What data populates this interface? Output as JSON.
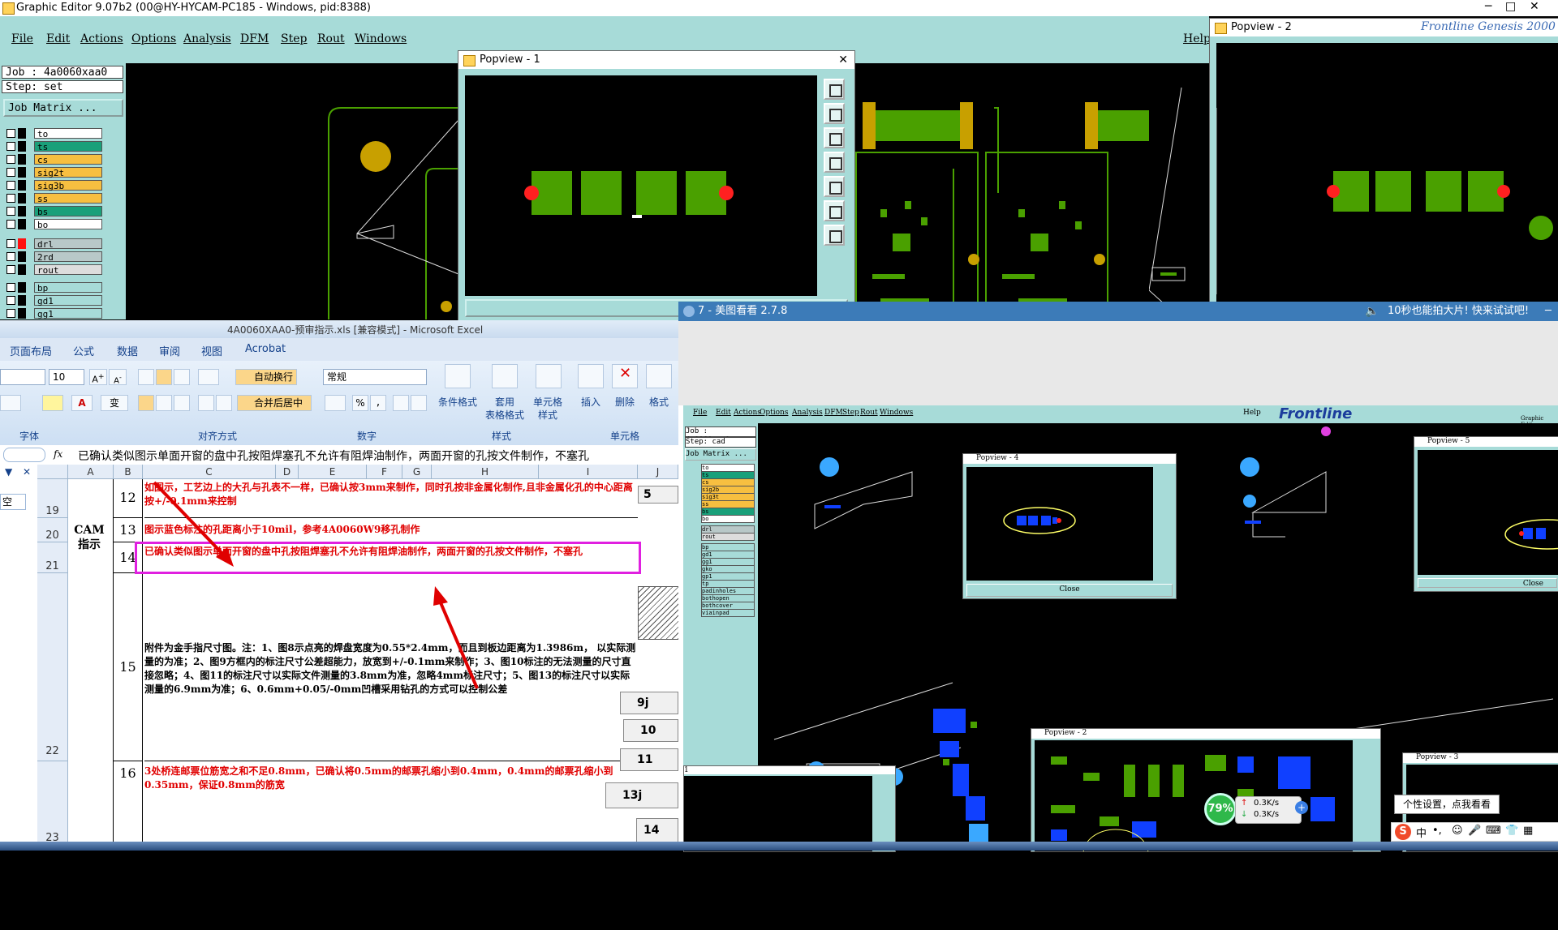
{
  "graphic_editor": {
    "title": "Graphic Editor 9.07b2 (00@HY-HYCAM-PC185 - Windows, pid:8388)",
    "menu": [
      "File",
      "Edit",
      "Actions",
      "Options",
      "Analysis",
      "DFM",
      "Step",
      "Rout",
      "Windows"
    ],
    "help": "Help",
    "job": "Job : 4a0060xaa0",
    "step": "Step: set",
    "job_matrix": "Job Matrix ...",
    "layers": [
      {
        "name": "to",
        "color": "#ffffff"
      },
      {
        "name": "ts",
        "color": "#1aa07a"
      },
      {
        "name": "cs",
        "color": "#f7bf40"
      },
      {
        "name": "sig2t",
        "color": "#f7bf40"
      },
      {
        "name": "sig3b",
        "color": "#f7bf40"
      },
      {
        "name": "ss",
        "color": "#f7bf40"
      },
      {
        "name": "bs",
        "color": "#1aa07a"
      },
      {
        "name": "bo",
        "color": "#ffffff"
      },
      {
        "name": "drl",
        "color": "#b8c8c8"
      },
      {
        "name": "2rd",
        "color": "#b8c8c8"
      },
      {
        "name": "rout",
        "color": "#dddddd"
      },
      {
        "name": "bp",
        "color": "#a7dbd8"
      },
      {
        "name": "gd1",
        "color": "#a7dbd8"
      },
      {
        "name": "gg1",
        "color": "#a7dbd8"
      }
    ],
    "popview1_title": "Popview - 1",
    "popview1_close": "Close",
    "popview2_title": "Popview - 2",
    "bg_logo": "Frontline  Genesis 2000"
  },
  "excel": {
    "title": "4A0060XAA0-预审指示.xls [兼容模式] - Microsoft Excel",
    "tabs": [
      "页面布局",
      "公式",
      "数据",
      "审阅",
      "视图",
      "Acrobat"
    ],
    "font_size": "10",
    "wrap_text": "自动换行",
    "merge_center": "合并后居中",
    "number_format": "常规",
    "groups": [
      "字体",
      "对齐方式",
      "数字",
      "样式",
      "单元格"
    ],
    "buttons": {
      "cond_format": "条件格式",
      "table_format_1": "套用",
      "table_format_2": "表格格式",
      "cell_style_1": "单元格",
      "cell_style_2": "样式",
      "insert": "插入",
      "delete": "删除",
      "format": "格式"
    },
    "formula_text": "已确认类似图示单面开窗的盘中孔按阻焊塞孔不允许有阻焊油制作，两面开窗的孔按文件制作，不塞孔",
    "columns": [
      "A",
      "B",
      "C",
      "D",
      "E",
      "F",
      "G",
      "H",
      "I",
      "J"
    ],
    "rows": [
      "19",
      "20",
      "21",
      "22",
      "23"
    ],
    "cam_label": "CAM指示",
    "left_pane_cell": "空",
    "items": [
      {
        "num": "12",
        "text": "如图示，工艺边上的大孔与孔表不一样，已确认按3mm来制作，同时孔按非金属化制作,且非金属化孔的中心距离按+/-0.1mm来控制"
      },
      {
        "num": "13",
        "text": "图示蓝色标注的孔距离小于10mil，参考4A0060W9移孔制作"
      },
      {
        "num": "14",
        "text": "已确认类似图示单面开窗的盘中孔按阻焊塞孔不允许有阻焊油制作，两面开窗的孔按文件制作，不塞孔"
      },
      {
        "num": "15",
        "text": "附件为金手指尺寸图。注：1、图8示点亮的焊盘宽度为0.55*2.4mm，而且到板边距离为1.3986m， 以实际测量的为准；2、图9方框内的标注尺寸公差超能力，放宽到+/-0.1mm来制作；3、图10标注的无法测量的尺寸直接忽略；4、图11的标注尺寸以实际文件测量的3.8mm为准，忽略4mm标注尺寸；5、图13的标注尺寸以实际测量的6.9mm为准；6、0.6mm+0.05/-0mm凹槽采用钻孔的方式可以控制公差"
      },
      {
        "num": "16",
        "text": "3处桥连邮票位筋宽之和不足0.8mm，已确认将0.5mm的邮票孔缩小到0.4mm，0.4mm的邮票孔缩小到0.35mm，保证0.8mm的筋宽"
      }
    ],
    "side_labels": [
      "5",
      "9j",
      "10",
      "11",
      "13j",
      "14"
    ]
  },
  "meitu": {
    "title": "7 - 美图看看 2.7.8",
    "ad": "10秒也能拍大片! 快来试试吧!",
    "inner": {
      "menu": [
        "File",
        "Edit",
        "Actions",
        "Options",
        "Analysis",
        "DFM",
        "Step",
        "Rout",
        "Windows"
      ],
      "help": "Help",
      "logo": "Frontline",
      "logo_sub": "Graphic Editor",
      "job": "Job : 4a0060xaa0",
      "step": "Step: cad",
      "job_matrix": "Job Matrix ...",
      "layers": [
        "to",
        "ts",
        "cs",
        "sig2b",
        "sig3t",
        "ss",
        "bs",
        "bo",
        "drl",
        "rout",
        "bp",
        "gd1",
        "gg1",
        "gko",
        "gp1",
        "tp",
        "padinholes",
        "bothopen",
        "bothcover",
        "viainpad"
      ],
      "pop4_title": "Popview - 4",
      "pop4_close": "Close",
      "pop5_title": "Popview - 5",
      "pop5_close": "Close",
      "pop2_title": "Popview - 2",
      "pop3_title": "Popview - 3",
      "pop1_num": "1"
    },
    "net_percent": "79%",
    "net_up": "0.3K/s",
    "net_down": "0.3K/s",
    "tooltip": "个性设置，点我看看",
    "ime": "中"
  },
  "colors": {
    "teal_bg": "#a7dbd8",
    "pad_green": "#4aa000",
    "gold": "#c8a000",
    "drill_red": "#ff2020",
    "pad_blue": "#1040ff"
  }
}
